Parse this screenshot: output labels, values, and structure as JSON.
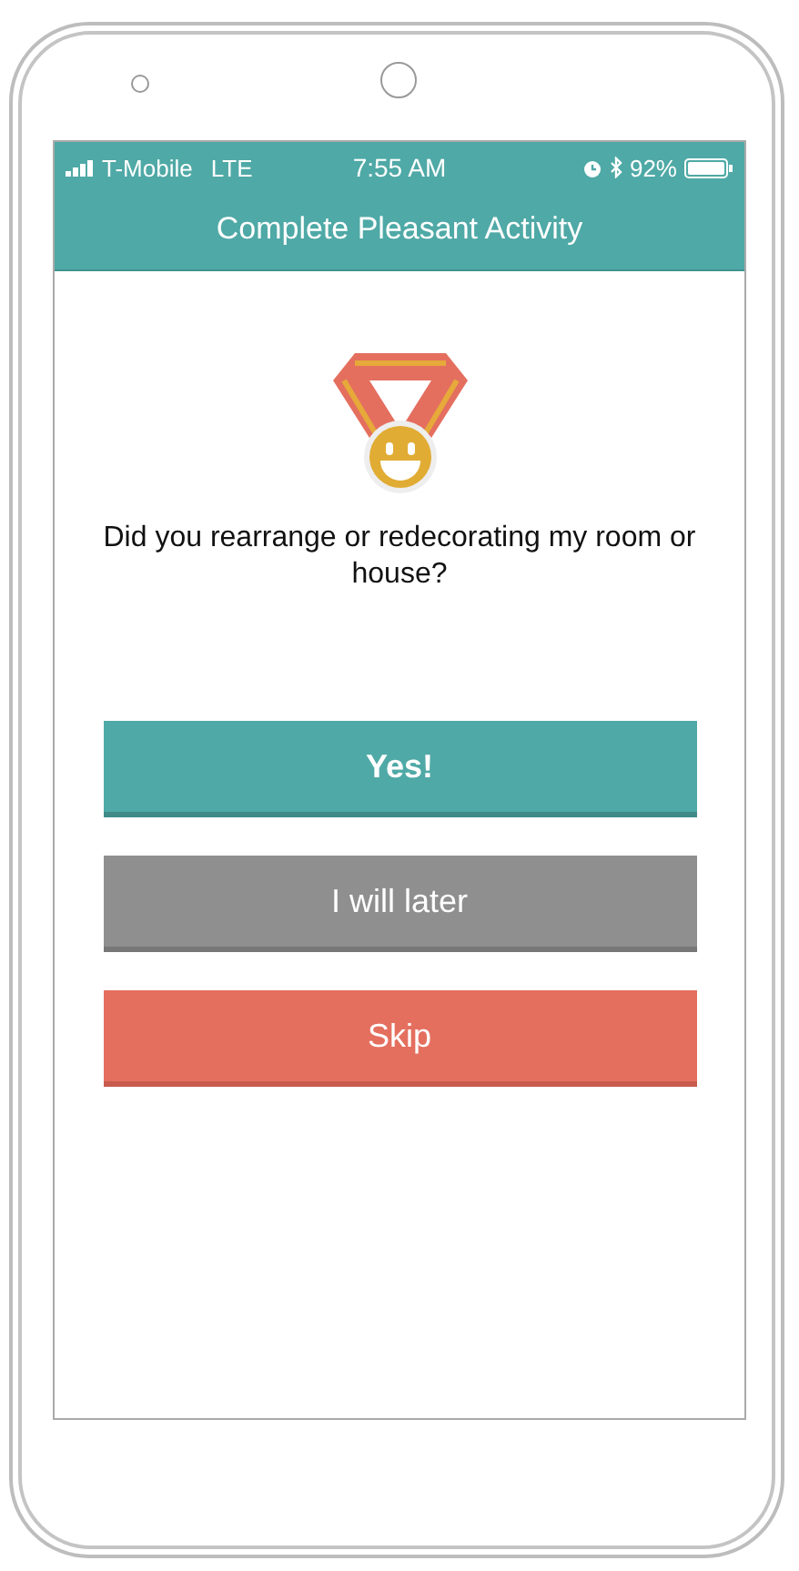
{
  "status_bar": {
    "carrier": "T-Mobile",
    "network": "LTE",
    "time": "7:55 AM",
    "battery": "92%"
  },
  "title": "Complete Pleasant Activity",
  "question": "Did you rearrange or redecorating my room or house?",
  "buttons": [
    {
      "label": "Yes!",
      "kind": "primary"
    },
    {
      "label": "I will later",
      "kind": "neutral"
    },
    {
      "label": "Skip",
      "kind": "danger"
    }
  ]
}
